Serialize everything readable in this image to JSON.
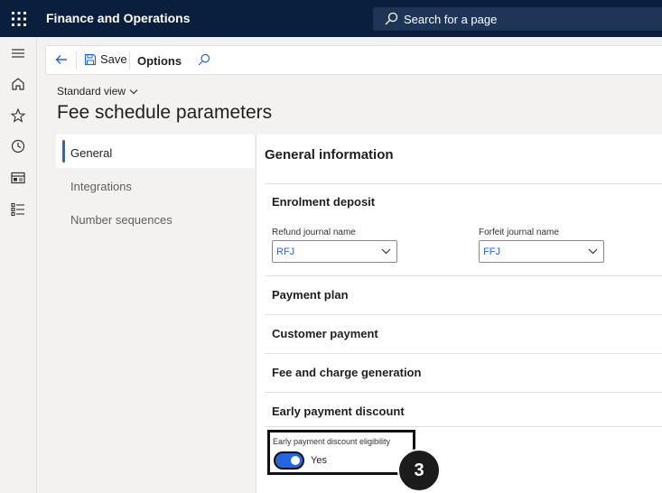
{
  "header": {
    "app_title": "Finance and Operations",
    "search_placeholder": "Search for a page"
  },
  "actionbar": {
    "save_label": "Save",
    "options_label": "Options"
  },
  "view": {
    "label": "Standard view"
  },
  "page_title": "Fee schedule parameters",
  "tabs": [
    {
      "label": "General"
    },
    {
      "label": "Integrations"
    },
    {
      "label": "Number sequences"
    }
  ],
  "panel": {
    "title": "General information",
    "sections": [
      {
        "title": "Enrolment deposit"
      },
      {
        "title": "Payment plan"
      },
      {
        "title": "Customer payment"
      },
      {
        "title": "Fee and charge generation"
      },
      {
        "title": "Early payment discount"
      }
    ],
    "fields": {
      "refund": {
        "label": "Refund journal name",
        "value": "RFJ"
      },
      "forfeit": {
        "label": "Forfeit journal name",
        "value": "FFJ"
      },
      "eligibility": {
        "label": "Early payment discount eligibility",
        "value": "Yes"
      }
    }
  },
  "step_badge": "3",
  "colors": {
    "topbar": "#0a1f3d",
    "accent": "#2266e3"
  }
}
